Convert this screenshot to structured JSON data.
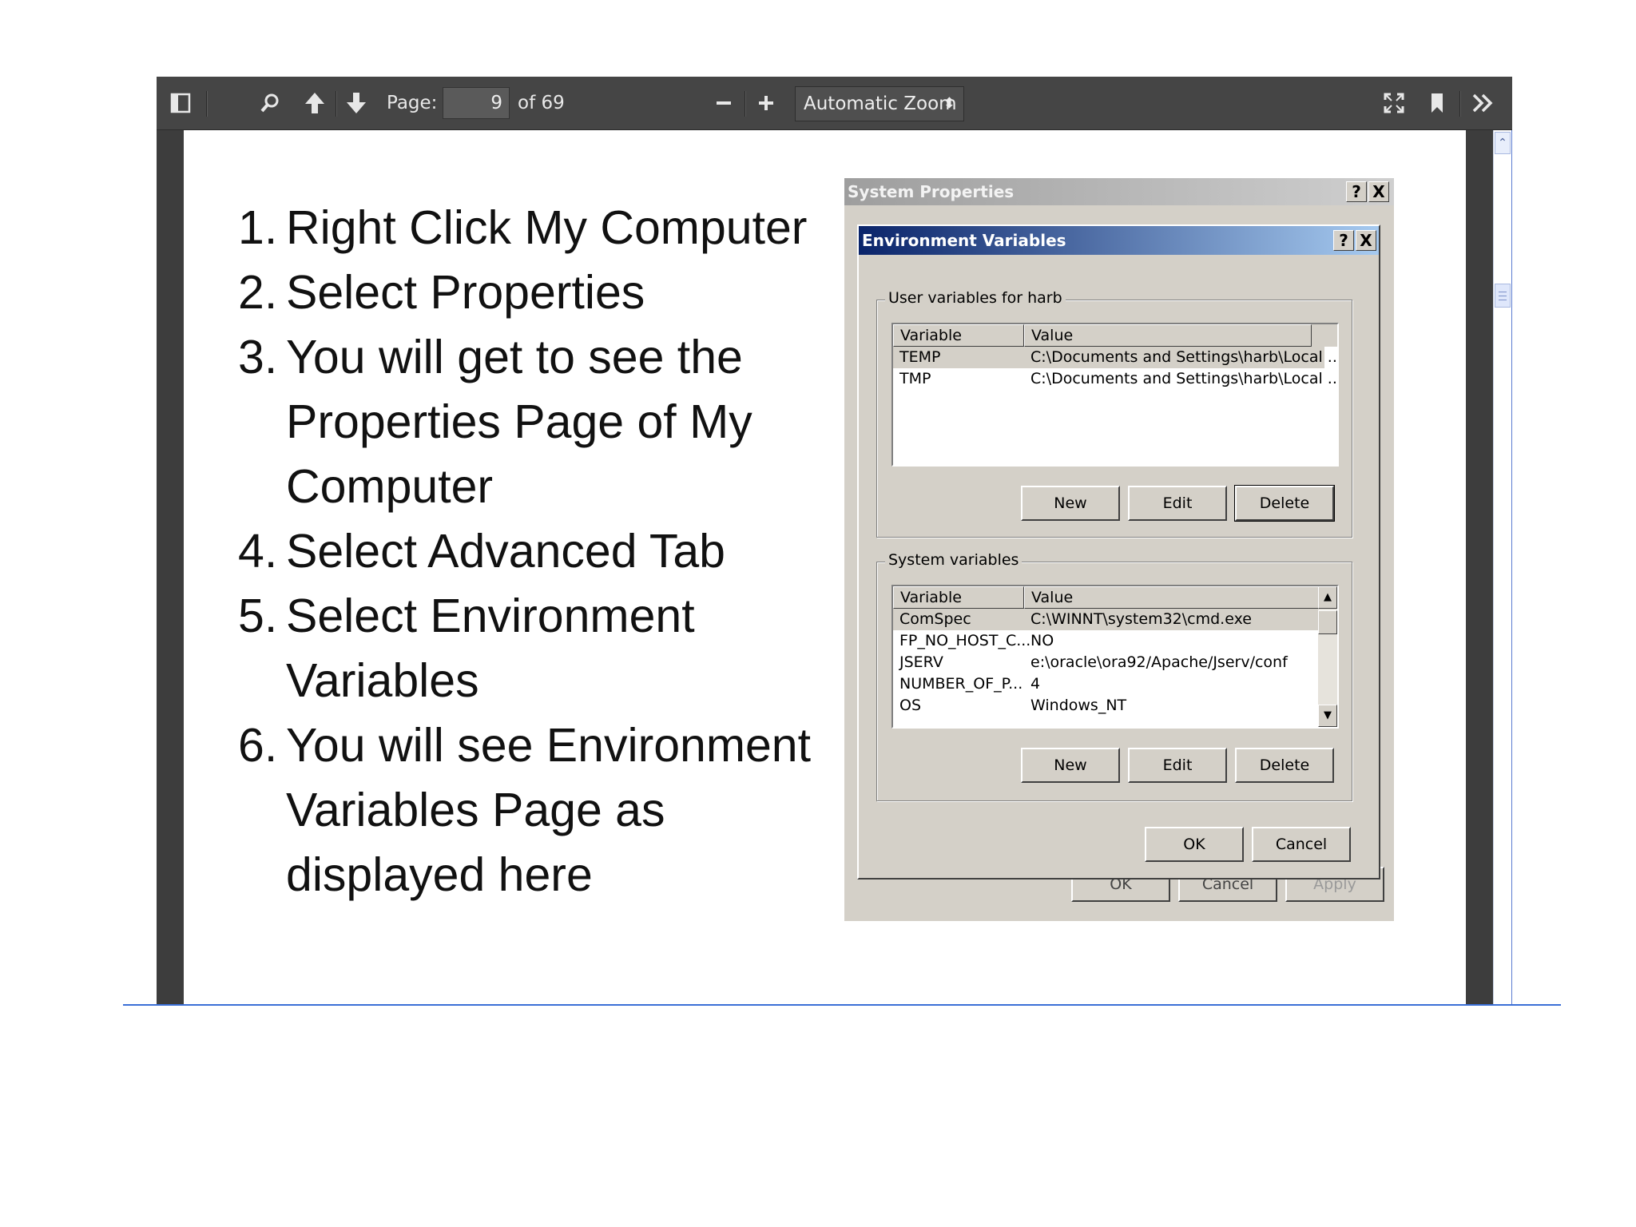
{
  "toolbar": {
    "page_label": "Page:",
    "page_number": "9",
    "page_of": "of 69",
    "zoom_label": "Automatic Zoom",
    "icons": [
      "sidebar-toggle-icon",
      "search-icon",
      "previous-page-icon",
      "next-page-icon",
      "zoom-out-icon",
      "zoom-in-icon",
      "presentation-mode-icon",
      "bookmark-icon",
      "tools-icon"
    ]
  },
  "slide": {
    "steps": [
      {
        "num": "1.",
        "lines": [
          "Right Click My Computer"
        ]
      },
      {
        "num": "2.",
        "lines": [
          "Select Properties"
        ]
      },
      {
        "num": "3.",
        "lines": [
          "You will get to see the",
          "Properties Page of My",
          "Computer"
        ]
      },
      {
        "num": "4.",
        "lines": [
          "Select Advanced Tab"
        ]
      },
      {
        "num": "5.",
        "lines": [
          "Select Environment",
          "Variables"
        ]
      },
      {
        "num": "6.",
        "lines": [
          "You will see Environment",
          "Variables Page as",
          "displayed here"
        ]
      }
    ]
  },
  "system_properties": {
    "title": "System Properties",
    "help_label": "?",
    "close_label": "X",
    "ok_label": "OK",
    "cancel_label": "Cancel",
    "apply_label": "Apply"
  },
  "env_dialog": {
    "title": "Environment Variables",
    "help_label": "?",
    "close_label": "X",
    "user_group_label": "User variables for harb",
    "system_group_label": "System variables",
    "col_variable": "Variable",
    "col_value": "Value",
    "user_vars": [
      {
        "name": "TEMP",
        "value": "C:\\Documents and Settings\\harb\\Local ..."
      },
      {
        "name": "TMP",
        "value": "C:\\Documents and Settings\\harb\\Local ..."
      }
    ],
    "system_vars": [
      {
        "name": "ComSpec",
        "value": "C:\\WINNT\\system32\\cmd.exe"
      },
      {
        "name": "FP_NO_HOST_C...",
        "value": "NO"
      },
      {
        "name": "JSERV",
        "value": "e:\\oracle\\ora92/Apache/Jserv/conf"
      },
      {
        "name": "NUMBER_OF_P...",
        "value": "4"
      },
      {
        "name": "OS",
        "value": "Windows_NT"
      }
    ],
    "new_label": "New",
    "edit_label": "Edit",
    "delete_label": "Delete",
    "ok_label": "OK",
    "cancel_label": "Cancel"
  }
}
